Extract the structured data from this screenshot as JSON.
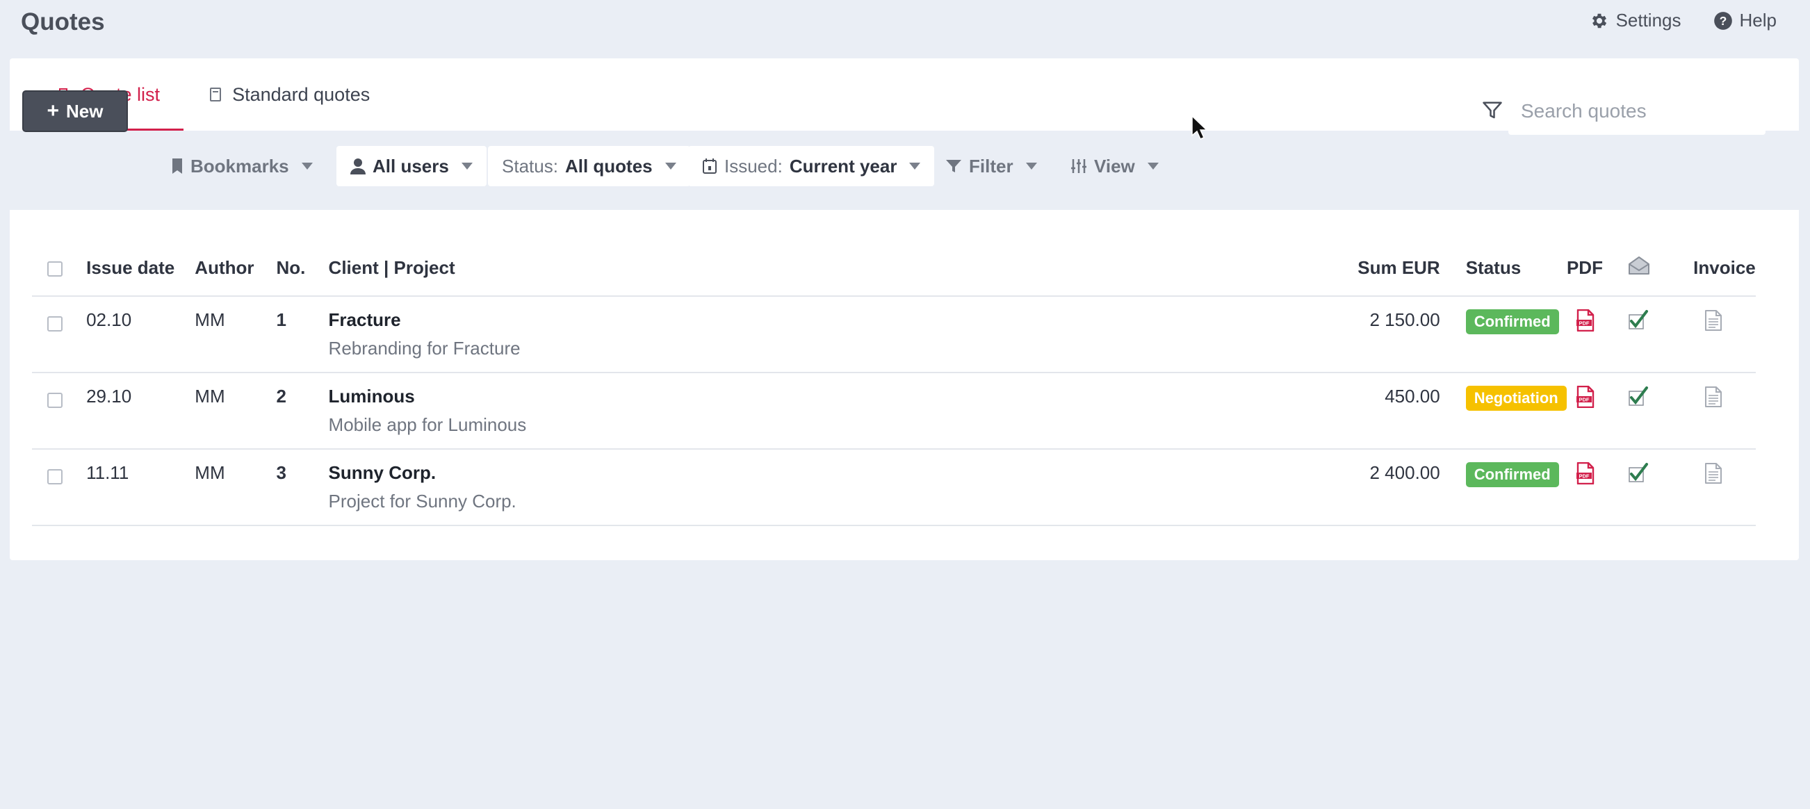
{
  "header": {
    "title": "Quotes",
    "settings_label": "Settings",
    "help_label": "Help"
  },
  "tabs": [
    {
      "label": "Quote list",
      "active": true
    },
    {
      "label": "Standard quotes",
      "active": false
    }
  ],
  "toolbar": {
    "new_label": "New",
    "bookmarks_label": "Bookmarks",
    "users_label": "All users",
    "status_prefix": "Status:",
    "status_value": "All quotes",
    "issued_prefix": "Issued:",
    "issued_value": "Current year",
    "filter_label": "Filter",
    "view_label": "View",
    "search_placeholder": "Search quotes"
  },
  "table": {
    "columns": {
      "issue_date": "Issue date",
      "author": "Author",
      "no": "No.",
      "client_project": "Client | Project",
      "sum": "Sum EUR",
      "status": "Status",
      "pdf": "PDF",
      "invoice": "Invoice"
    },
    "rows": [
      {
        "date": "02.10",
        "author": "MM",
        "no": "1",
        "client": "Fracture",
        "project": "Rebranding for Fracture",
        "sum": "2 150.00",
        "status": "Confirmed"
      },
      {
        "date": "29.10",
        "author": "MM",
        "no": "2",
        "client": "Luminous",
        "project": "Mobile app for Luminous",
        "sum": "450.00",
        "status": "Negotiation"
      },
      {
        "date": "11.11",
        "author": "MM",
        "no": "3",
        "client": "Sunny Corp.",
        "project": "Project for Sunny Corp.",
        "sum": "2 400.00",
        "status": "Confirmed"
      }
    ]
  },
  "colors": {
    "accent": "#d2204b",
    "confirmed": "#5cb85c",
    "negotiation": "#f6c100",
    "check": "#2e7d4f"
  }
}
